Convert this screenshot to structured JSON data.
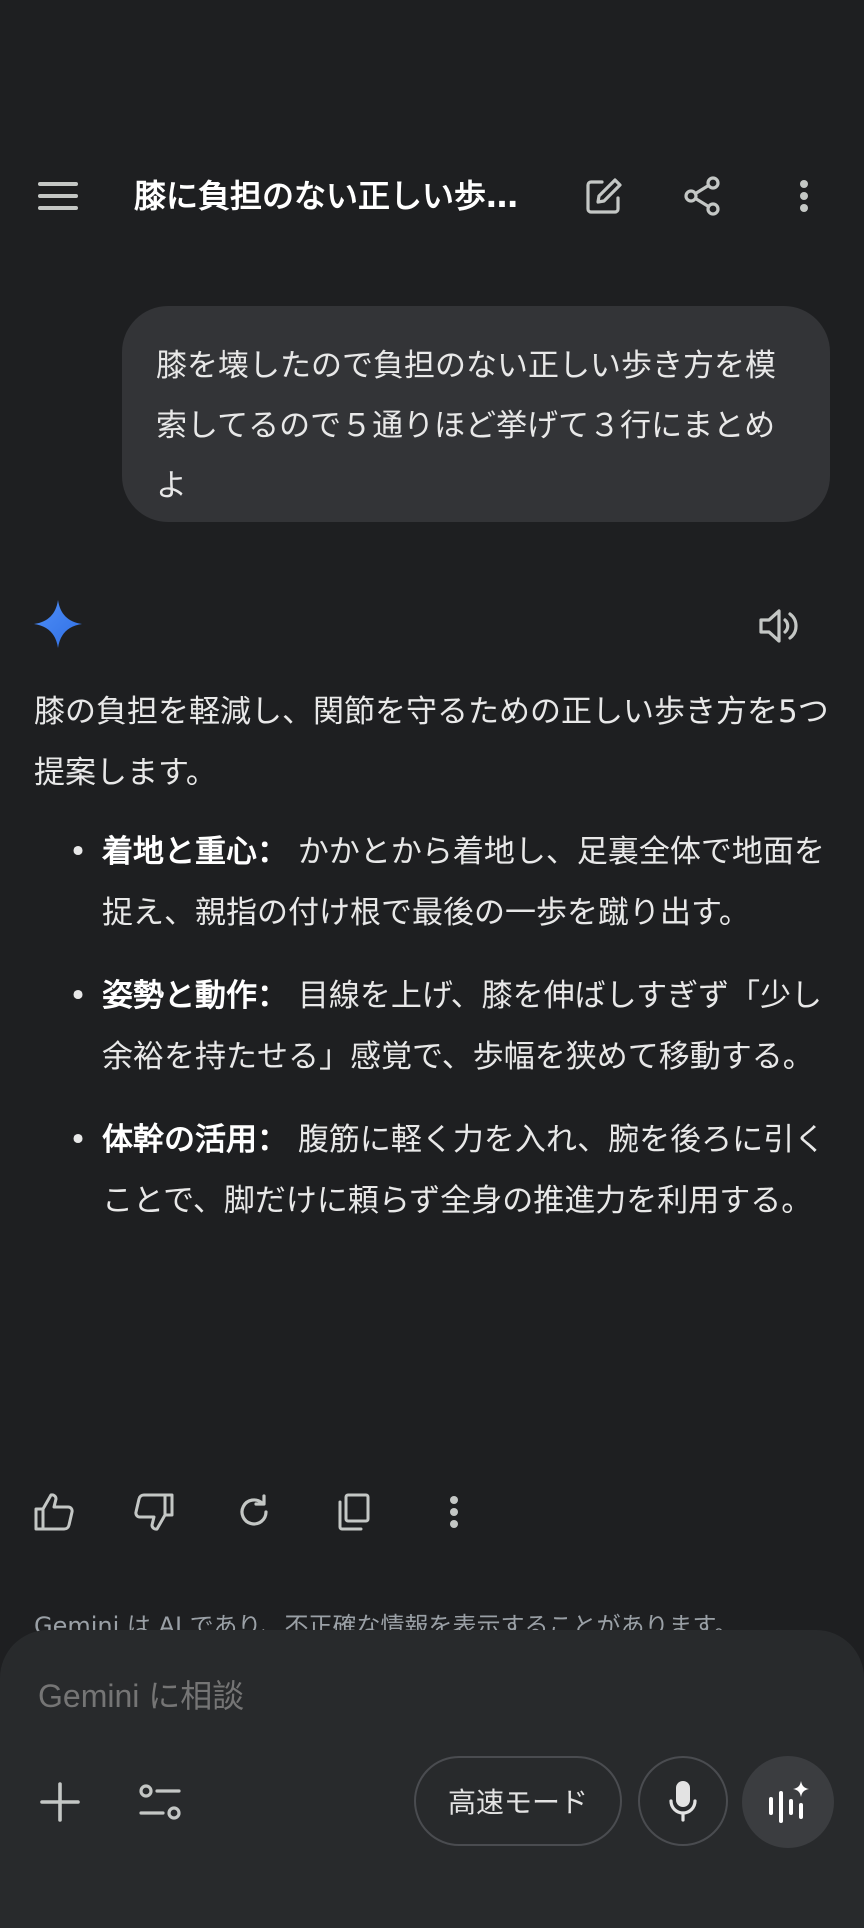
{
  "header": {
    "title": "膝に負担のない正しい歩き方"
  },
  "user_message": "膝を壊したので負担のない正しい歩き方を模索してるので５通りほど挙げて３行にまとめよ",
  "response": {
    "intro": "膝の負担を軽減し、関節を守るための正しい歩き方を5つ提案します。",
    "bullets": [
      {
        "title": "着地と重心：",
        "text": " かかとから着地し、足裏全体で地面を捉え、親指の付け根で最後の一歩を蹴り出す。"
      },
      {
        "title": "姿勢と動作：",
        "text": " 目線を上げ、膝を伸ばしすぎず「少し余裕を持たせる」感覚で、歩幅を狭めて移動する。"
      },
      {
        "title": "体幹の活用：",
        "text": " 腹筋に軽く力を入れ、腕を後ろに引くことで、脚だけに頼らず全身の推進力を利用する。"
      }
    ]
  },
  "disclaimer": "Gemini は AI であり、不正確な情報を表示することがあります。",
  "composer": {
    "placeholder": "Gemini に相談",
    "mode_label": "高速モード"
  },
  "colors": {
    "background": "#1e1f21",
    "bubble": "#333437",
    "composer": "#282a2c",
    "gemini_blue": "#4285f4"
  }
}
